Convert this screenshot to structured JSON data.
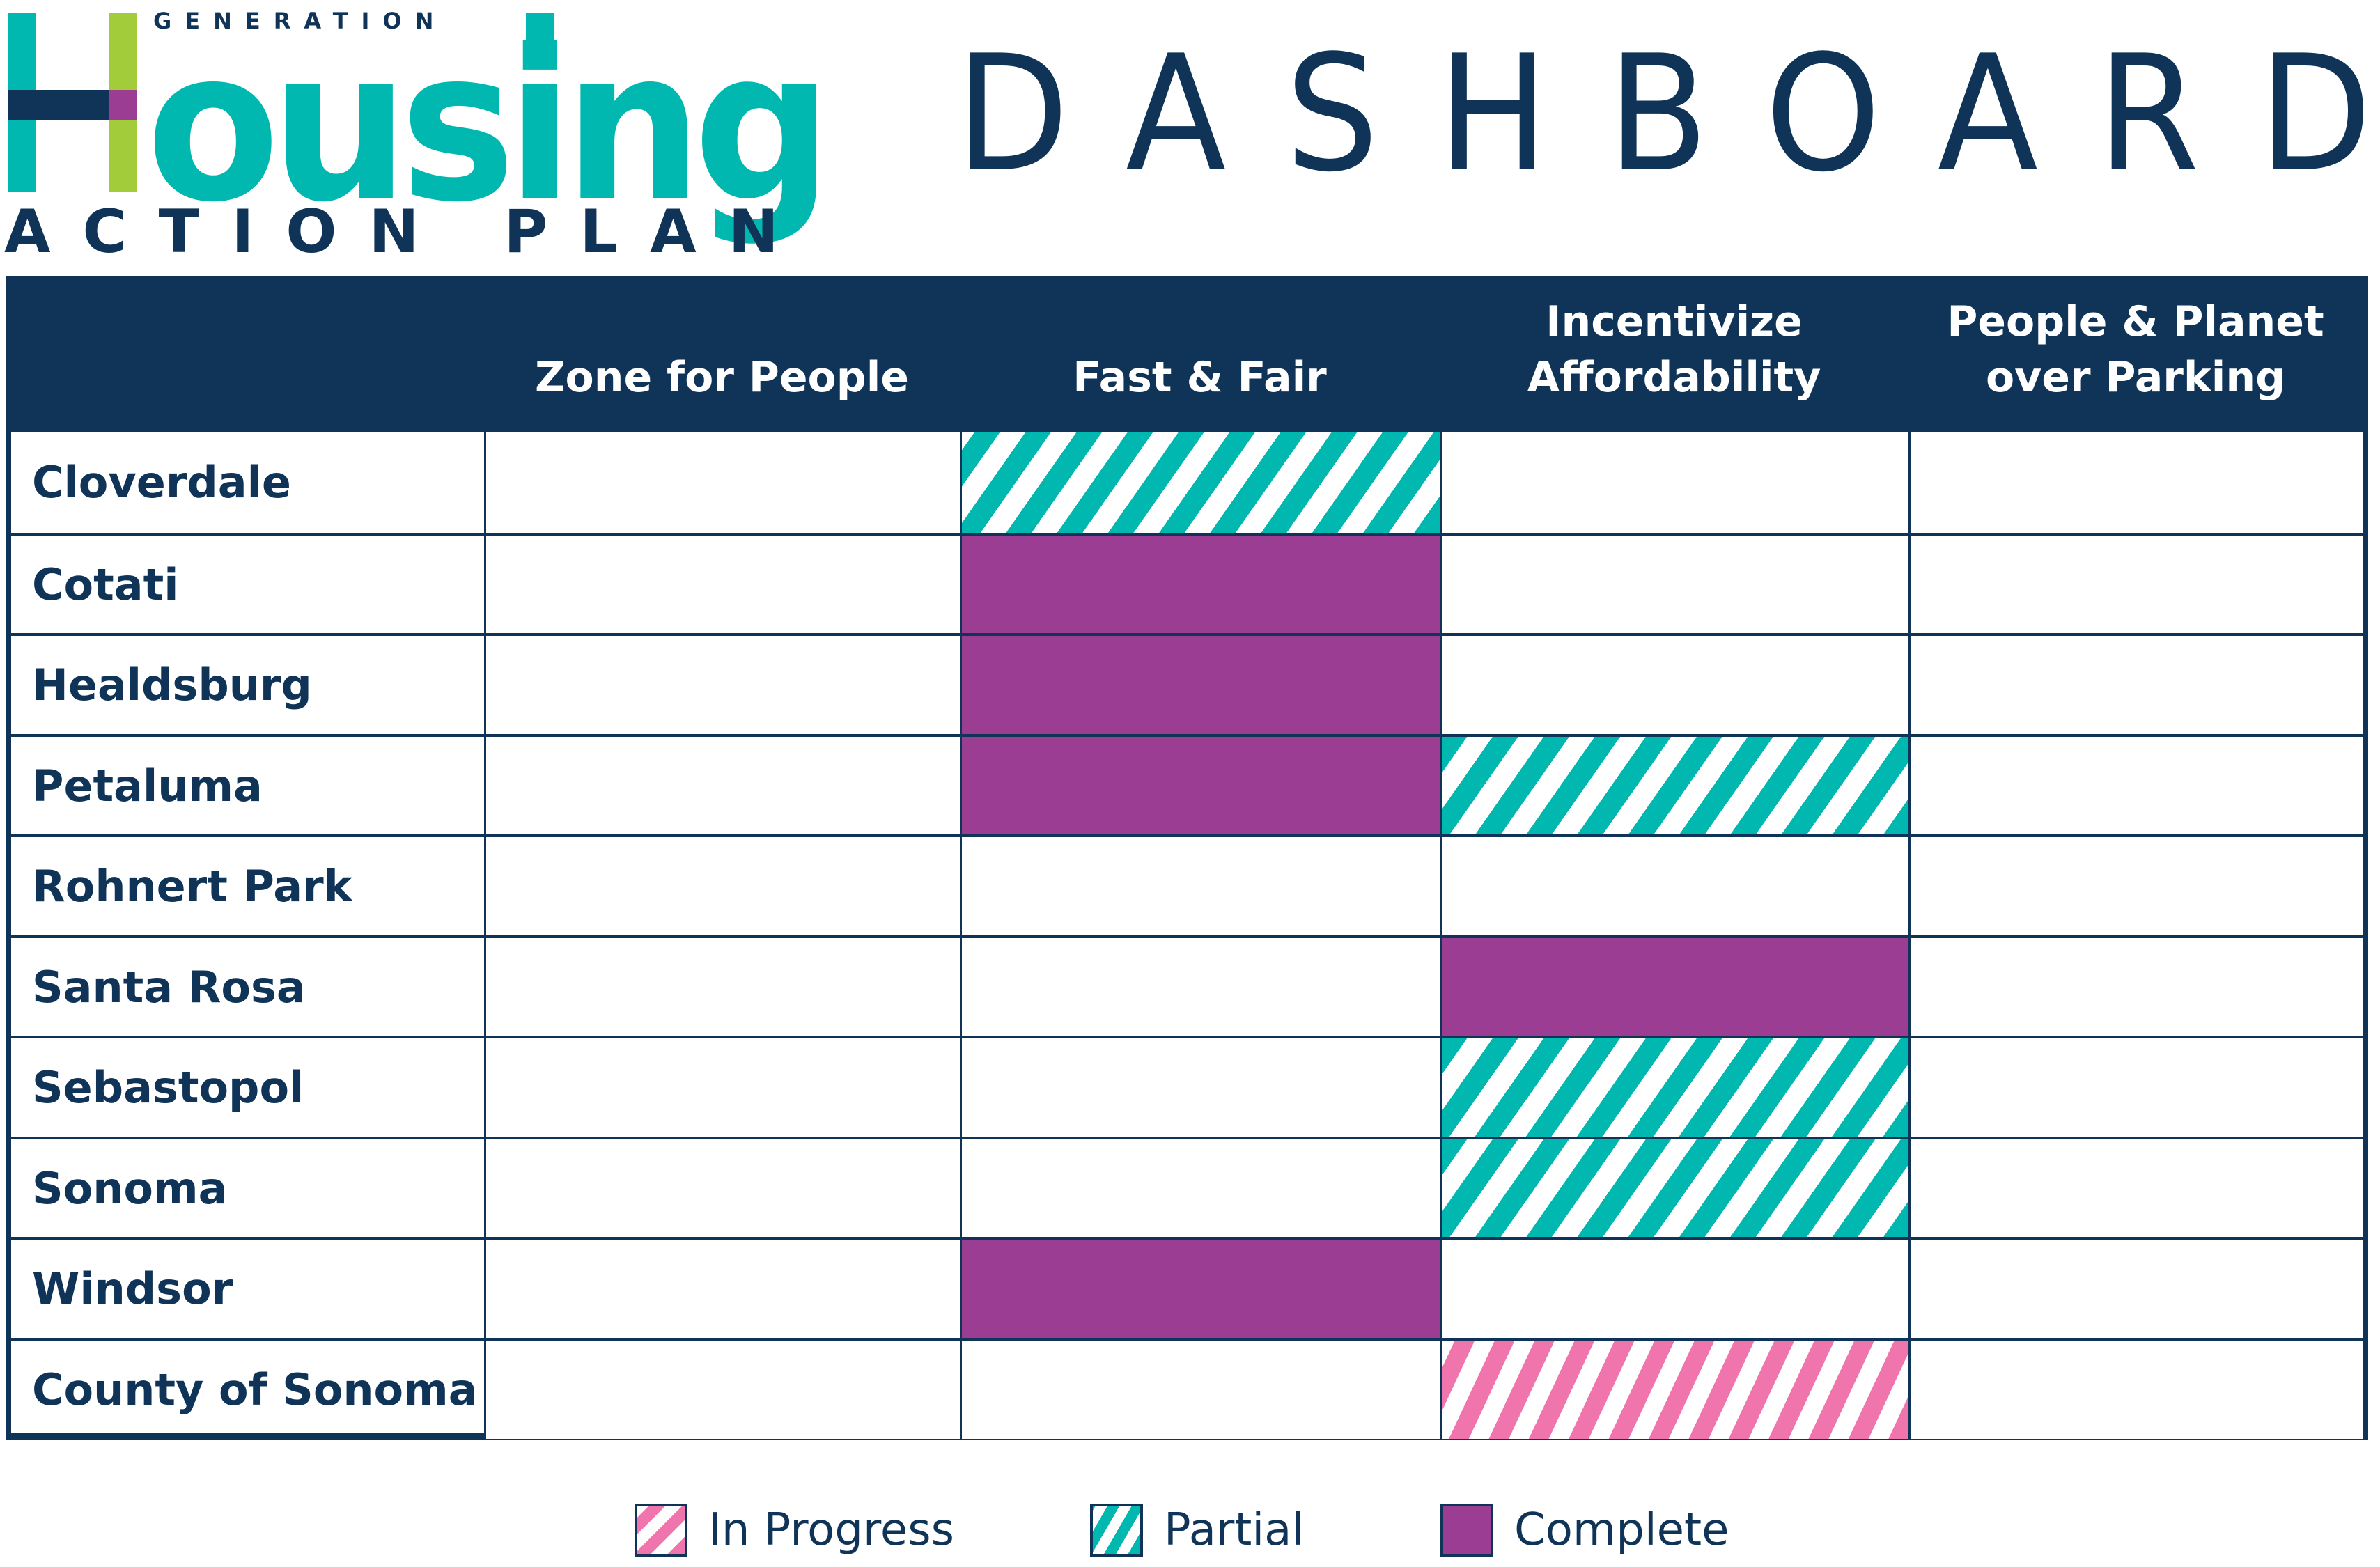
{
  "logo": {
    "top_text": "GENERATION",
    "main_text": "ousing",
    "initial": "H",
    "bottom_text": "ACTION PLAN",
    "colors": {
      "teal": "#00B8B0",
      "lime": "#A3CC3A",
      "navy": "#0F3457",
      "purple": "#9A3D93"
    }
  },
  "title": "DASHBOARD",
  "colors": {
    "navy": "#0F3457",
    "teal": "#00B8B0",
    "purple": "#9A3D93",
    "pink": "#F075AC"
  },
  "chart_data": {
    "type": "table",
    "title": "DASHBOARD",
    "columns": [
      "",
      "Zone for People",
      "Fast & Fair",
      "Incentivize\nAffordability",
      "People & Planet\nover Parking"
    ],
    "status_legend": {
      "in_progress": "In Progress",
      "partial": "Partial",
      "complete": "Complete",
      "none": ""
    },
    "rows": [
      {
        "name": "Cloverdale",
        "statuses": [
          "none",
          "partial",
          "none",
          "none"
        ]
      },
      {
        "name": "Cotati",
        "statuses": [
          "none",
          "complete",
          "none",
          "none"
        ]
      },
      {
        "name": "Healdsburg",
        "statuses": [
          "none",
          "complete",
          "none",
          "none"
        ]
      },
      {
        "name": "Petaluma",
        "statuses": [
          "none",
          "complete",
          "partial",
          "none"
        ]
      },
      {
        "name": "Rohnert Park",
        "statuses": [
          "none",
          "none",
          "none",
          "none"
        ]
      },
      {
        "name": "Santa Rosa",
        "statuses": [
          "none",
          "none",
          "complete",
          "none"
        ]
      },
      {
        "name": "Sebastopol",
        "statuses": [
          "none",
          "none",
          "partial",
          "none"
        ]
      },
      {
        "name": "Sonoma",
        "statuses": [
          "none",
          "none",
          "partial",
          "none"
        ]
      },
      {
        "name": "Windsor",
        "statuses": [
          "none",
          "complete",
          "none",
          "none"
        ]
      },
      {
        "name": "County of Sonoma",
        "statuses": [
          "none",
          "none",
          "in_progress",
          "none"
        ]
      }
    ],
    "legend": [
      {
        "key": "in_progress",
        "label": "In Progress",
        "color": "#F075AC",
        "pattern": "striped"
      },
      {
        "key": "partial",
        "label": "Partial",
        "color": "#00B8B0",
        "pattern": "striped"
      },
      {
        "key": "complete",
        "label": "Complete",
        "color": "#9A3D93",
        "pattern": "solid"
      }
    ],
    "legend_position": "bottom-center"
  }
}
